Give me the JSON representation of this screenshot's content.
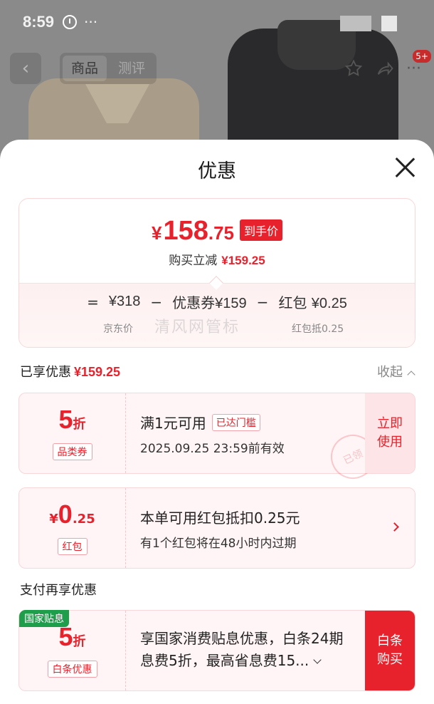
{
  "status_bar": {
    "time": "8:59",
    "more": "···"
  },
  "nav": {
    "back_glyph": "‹",
    "tabs": [
      "商品",
      "测评"
    ],
    "active_tab": 0,
    "badge": "5+"
  },
  "sheet": {
    "title": "优惠",
    "price": {
      "currency": "¥",
      "integer": "158",
      "decimal": ".75",
      "tag": "到手价"
    },
    "reduce": {
      "label": "购买立减",
      "value": "¥159.25"
    },
    "formula": {
      "eq": "=",
      "items": [
        {
          "value": "¥318",
          "label": "京东价"
        },
        {
          "op": "−",
          "prefix": "优惠券",
          "value": "¥159",
          "label": ""
        },
        {
          "op": "−",
          "prefix": "红包",
          "value": "¥0.25",
          "label": "红包抵0.25"
        }
      ],
      "watermark": "清风网管标"
    },
    "enjoyed": {
      "label": "已享优惠",
      "value": "¥159.25",
      "collapse": "收起"
    },
    "coupons": [
      {
        "big": "5",
        "unit": "折",
        "chip": "品类券",
        "line1": "满1元可用",
        "reached": "已达门槛",
        "line2": "2025.09.25 23:59前有效",
        "action": "立即\n使用",
        "stamp": "已领"
      },
      {
        "prefix": "¥",
        "big": "0",
        "unit": ".25",
        "chip": "红包",
        "line1": "本单可用红包抵扣0.25元",
        "line2": "有1个红包将在48小时内过期"
      }
    ],
    "pay_title": "支付再享优惠",
    "gov": {
      "label": "国家贴息",
      "big": "5",
      "unit": "折",
      "chip": "白条优惠",
      "text": "享国家消费贴息优惠，白条24期息费5折，最高省息费15...",
      "action": "白条\n购买"
    }
  },
  "colors": {
    "accent": "#e8222c",
    "gov_green": "#1e9e4a",
    "card_bg": "#fff5f6"
  },
  "icons": [
    "clock-icon",
    "back-icon",
    "star-icon",
    "share-icon",
    "more-icon",
    "close-icon",
    "chevron-up-icon",
    "chevron-right-icon",
    "chevron-down-icon"
  ]
}
